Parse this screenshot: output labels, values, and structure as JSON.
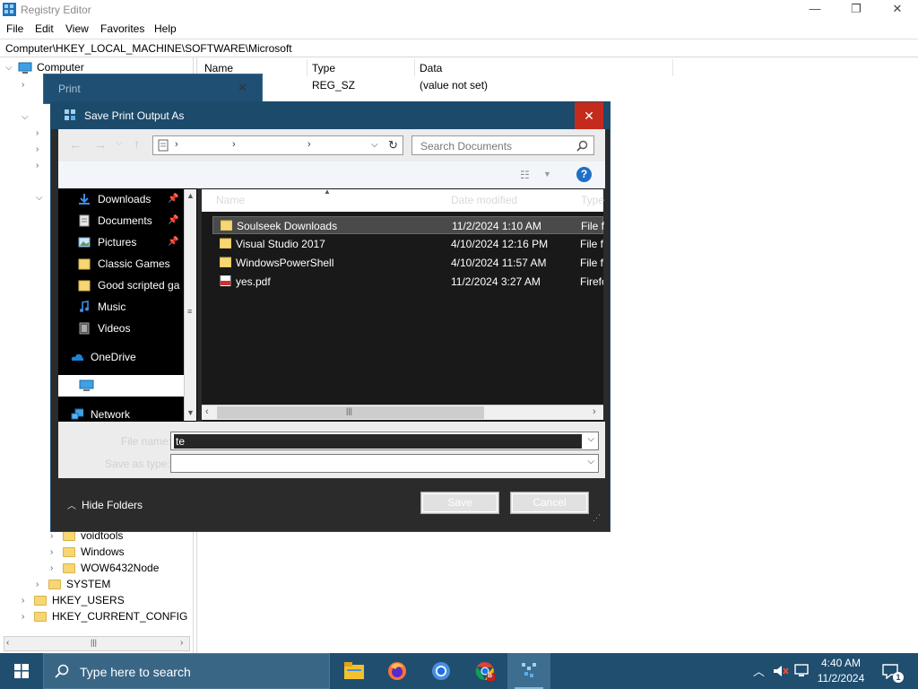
{
  "regedit": {
    "title": "Registry Editor",
    "menu": [
      "File",
      "Edit",
      "View",
      "Favorites",
      "Help"
    ],
    "address": "Computer\\HKEY_LOCAL_MACHINE\\SOFTWARE\\Microsoft",
    "controls": {
      "minimize": "—",
      "maximize": "❐",
      "close": "✕"
    },
    "columns": {
      "name": "Name",
      "type": "Type",
      "data": "Data"
    },
    "values": [
      {
        "type": "REG_SZ",
        "data": "(value not set)"
      }
    ],
    "tree": {
      "root": "Computer",
      "visible_nodes": [
        "voidtools",
        "Windows",
        "WOW6432Node",
        "SYSTEM",
        "HKEY_USERS",
        "HKEY_CURRENT_CONFIG"
      ]
    }
  },
  "print_window": {
    "title": "Print",
    "close": "✕"
  },
  "save_dialog": {
    "title": "Save Print Output As",
    "close": "✕",
    "search_placeholder": "Search Documents",
    "help": "?",
    "sidebar": [
      {
        "label": "Downloads",
        "icon": "downloads-icon",
        "pinned": true
      },
      {
        "label": "Documents",
        "icon": "documents-icon",
        "pinned": true
      },
      {
        "label": "Pictures",
        "icon": "pictures-icon",
        "pinned": true
      },
      {
        "label": "Classic Games",
        "icon": "folder-icon",
        "pinned": false
      },
      {
        "label": "Good scripted ga",
        "icon": "folder-icon",
        "pinned": false
      },
      {
        "label": "Music",
        "icon": "music-icon",
        "pinned": false
      },
      {
        "label": "Videos",
        "icon": "videos-icon",
        "pinned": false
      },
      {
        "label": "OneDrive",
        "icon": "onedrive-icon",
        "pinned": false
      },
      {
        "label": "",
        "icon": "this-pc-icon",
        "pinned": false
      },
      {
        "label": "Network",
        "icon": "network-icon",
        "pinned": false
      }
    ],
    "file_columns": {
      "name": "Name",
      "date": "Date modified",
      "type": "Type"
    },
    "files": [
      {
        "name": "Soulseek Downloads",
        "date": "11/2/2024 1:10 AM",
        "type": "File fo",
        "icon": "folder-icon",
        "selected": true
      },
      {
        "name": "Visual Studio 2017",
        "date": "4/10/2024 12:16 PM",
        "type": "File fo",
        "icon": "folder-icon",
        "selected": false
      },
      {
        "name": "WindowsPowerShell",
        "date": "4/10/2024 11:57 AM",
        "type": "File fo",
        "icon": "folder-icon",
        "selected": false
      },
      {
        "name": "yes.pdf",
        "date": "11/2/2024 3:27 AM",
        "type": "Firefo",
        "icon": "pdf-icon",
        "selected": false
      }
    ],
    "filename_label": "File name:",
    "filename_value": "te",
    "savetype_label": "Save as type:",
    "hide_folders": "Hide Folders",
    "save_button": "Save",
    "cancel_button": "Cancel"
  },
  "taskbar": {
    "search_placeholder": "Type here to search",
    "time": "4:40 AM",
    "date": "11/2/2024",
    "notification_count": "1",
    "apps": [
      "file-explorer-icon",
      "firefox-icon",
      "chrome-icon",
      "chrome-beta-icon",
      "regedit-icon"
    ]
  },
  "colors": {
    "taskbar": "#1f4e6f",
    "dialog_title": "#1c4a6b",
    "close_red": "#c42b1c",
    "dark_pane": "#191919"
  }
}
